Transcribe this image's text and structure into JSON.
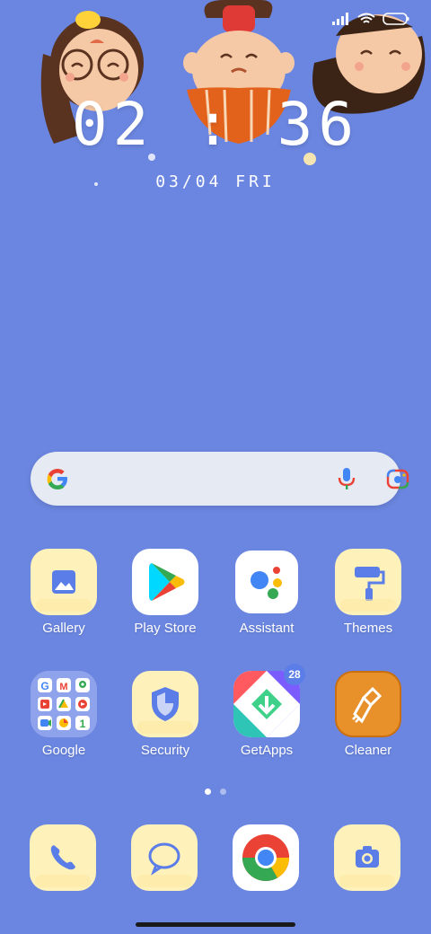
{
  "status": {
    "signal_icon": "signal-bars-icon",
    "wifi_icon": "wifi-icon",
    "battery_icon": "battery-icon"
  },
  "lockscreen": {
    "time": "02 : 36",
    "date": "03/04 FRI"
  },
  "search_bar": {
    "logo_icon": "google-g-icon",
    "voice_icon": "microphone-icon",
    "lens_icon": "camera-lens-icon"
  },
  "apps": [
    {
      "label": "Gallery",
      "icon": "gallery-icon"
    },
    {
      "label": "Play Store",
      "icon": "play-store-icon"
    },
    {
      "label": "Assistant",
      "icon": "assistant-icon"
    },
    {
      "label": "Themes",
      "icon": "paint-roller-icon"
    },
    {
      "label": "Google",
      "icon": "google-folder-icon"
    },
    {
      "label": "Security",
      "icon": "shield-icon"
    },
    {
      "label": "GetApps",
      "icon": "getapps-icon",
      "badge": "28"
    },
    {
      "label": "Cleaner",
      "icon": "broom-icon"
    }
  ],
  "pager": {
    "pages": 2,
    "current": 1
  },
  "dock": [
    {
      "icon": "phone-icon"
    },
    {
      "icon": "messages-icon"
    },
    {
      "icon": "chrome-icon"
    },
    {
      "icon": "camera-icon"
    }
  ],
  "colors": {
    "wallpaper": "#6b86e0",
    "tile_yellow": "#fef1ba",
    "icon_blue": "#5b7de8",
    "cleaner_orange": "#e8902a"
  }
}
